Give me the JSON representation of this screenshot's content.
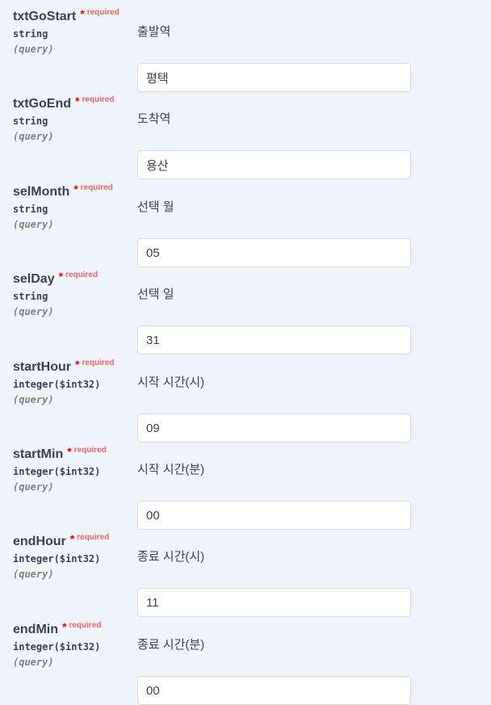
{
  "required_label": "required",
  "required_star": "*",
  "params": [
    {
      "name": "txtGoStart",
      "type": "string",
      "in": "(query)",
      "description": "출발역",
      "value": "평택"
    },
    {
      "name": "txtGoEnd",
      "type": "string",
      "in": "(query)",
      "description": "도착역",
      "value": "용산"
    },
    {
      "name": "selMonth",
      "type": "string",
      "in": "(query)",
      "description": "선택 월",
      "value": "05"
    },
    {
      "name": "selDay",
      "type": "string",
      "in": "(query)",
      "description": "선택 일",
      "value": "31"
    },
    {
      "name": "startHour",
      "type": "integer($int32)",
      "in": "(query)",
      "description": "시작 시간(시)",
      "value": "09"
    },
    {
      "name": "startMin",
      "type": "integer($int32)",
      "in": "(query)",
      "description": "시작 시간(분)",
      "value": "00"
    },
    {
      "name": "endHour",
      "type": "integer($int32)",
      "in": "(query)",
      "description": "종료 시간(시)",
      "value": "11"
    },
    {
      "name": "endMin",
      "type": "integer($int32)",
      "in": "(query)",
      "description": "종료 시간(분)",
      "value": "00"
    }
  ]
}
